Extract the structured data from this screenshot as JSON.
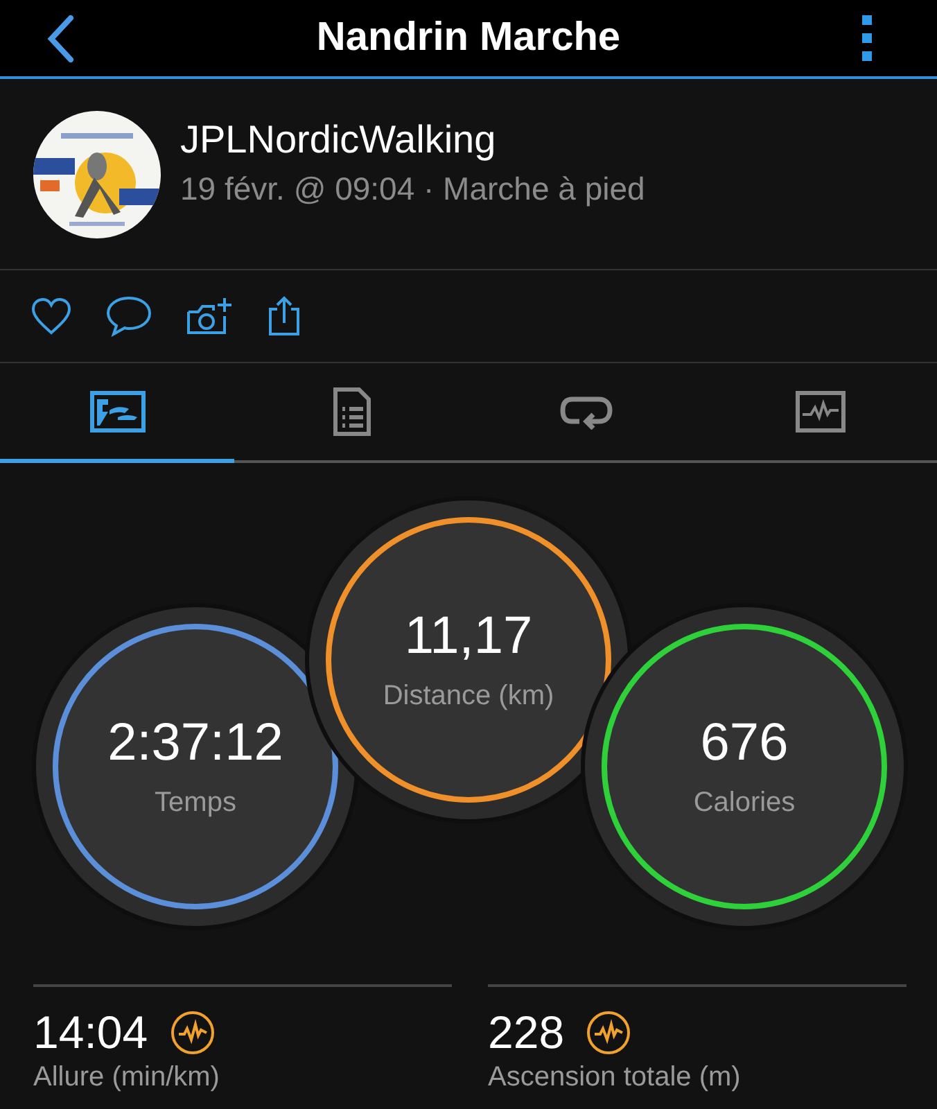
{
  "header": {
    "title": "Nandrin Marche"
  },
  "post": {
    "author": "JPLNordicWalking",
    "meta": "19 févr. @ 09:04 · Marche à pied"
  },
  "actions": [
    {
      "kind": "heart"
    },
    {
      "kind": "comment"
    },
    {
      "kind": "camera"
    },
    {
      "kind": "share"
    }
  ],
  "tabs": [
    {
      "kind": "summary",
      "selected": true
    },
    {
      "kind": "document",
      "selected": false
    },
    {
      "kind": "laps",
      "selected": false
    },
    {
      "kind": "chart",
      "selected": false
    }
  ],
  "circles": [
    {
      "value": "2:37:12",
      "label": "Temps",
      "color": "#5b8fd9"
    },
    {
      "value": "11,17",
      "label": "Distance (km)",
      "color": "#f0902a"
    },
    {
      "value": "676",
      "label": "Calories",
      "color": "#2fd13a"
    }
  ],
  "stats": [
    {
      "value": "14:04",
      "label": "Allure (min/km)"
    },
    {
      "value": "228",
      "label": "Ascension totale (m)"
    }
  ]
}
